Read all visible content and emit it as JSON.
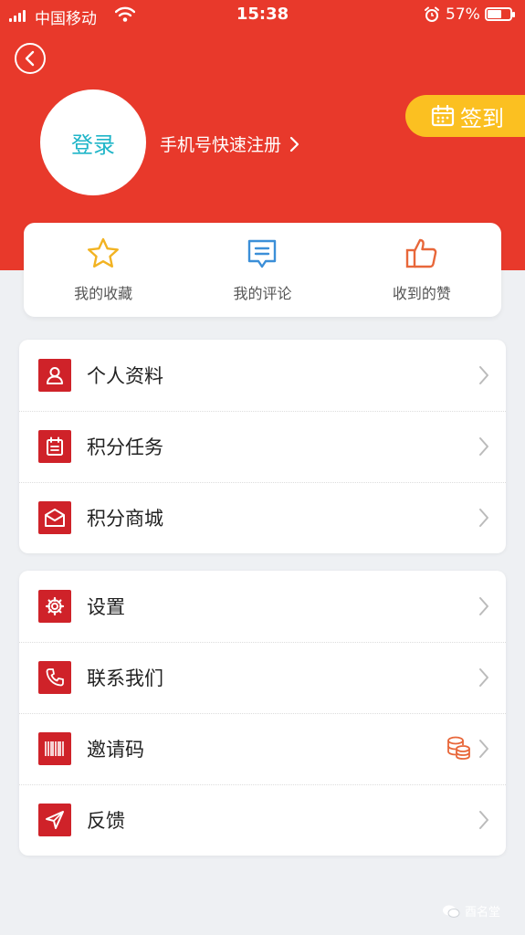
{
  "status_bar": {
    "carrier": "中国移动",
    "time": "15:38",
    "battery": "57%",
    "battery_level": 0.57
  },
  "profile": {
    "login_label": "登录",
    "register_link": "手机号快速注册",
    "signin_label": "签到"
  },
  "quick_actions": [
    {
      "label": "我的收藏",
      "icon": "star-icon"
    },
    {
      "label": "我的评论",
      "icon": "comment-icon"
    },
    {
      "label": "收到的赞",
      "icon": "thumbs-up-icon"
    }
  ],
  "menu_group_1": [
    {
      "label": "个人资料",
      "icon": "user-icon"
    },
    {
      "label": "积分任务",
      "icon": "calendar-icon"
    },
    {
      "label": "积分商城",
      "icon": "shop-icon"
    }
  ],
  "menu_group_2": [
    {
      "label": "设置",
      "icon": "gear-icon"
    },
    {
      "label": "联系我们",
      "icon": "phone-icon"
    },
    {
      "label": "邀请码",
      "icon": "barcode-icon"
    },
    {
      "label": "反馈",
      "icon": "send-icon"
    }
  ],
  "watermark": "酉名堂",
  "colors": {
    "header": "#e8392b",
    "signin": "#fbc021",
    "menu_icon": "#cf2229",
    "login_text": "#1fb5c8"
  }
}
